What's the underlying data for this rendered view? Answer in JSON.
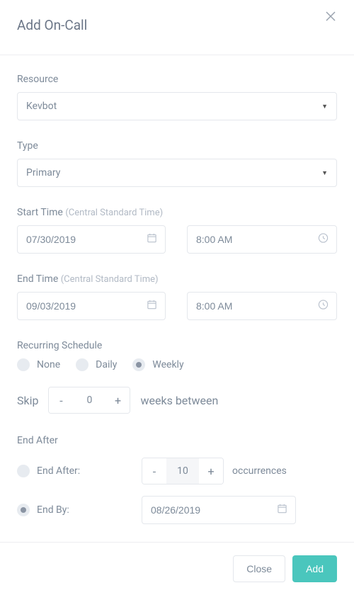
{
  "header": {
    "title": "Add On-Call"
  },
  "resource": {
    "label": "Resource",
    "value": "Kevbot"
  },
  "type": {
    "label": "Type",
    "value": "Primary"
  },
  "start": {
    "label": "Start Time",
    "suffix": "(Central Standard Time)",
    "date": "07/30/2019",
    "time": "8:00 AM"
  },
  "end": {
    "label": "End Time",
    "suffix": "(Central Standard Time)",
    "date": "09/03/2019",
    "time": "8:00 AM"
  },
  "recurring": {
    "label": "Recurring Schedule",
    "options": {
      "none": "None",
      "daily": "Daily",
      "weekly": "Weekly"
    },
    "selected": "weekly",
    "skip": {
      "label": "Skip",
      "value": "0",
      "suffix": "weeks between"
    }
  },
  "endAfter": {
    "label": "End After",
    "endAfterLabel": "End After:",
    "occurrences": "10",
    "occurrencesLabel": "occurrences",
    "endByLabel": "End By:",
    "endByDate": "08/26/2019",
    "selected": "endby"
  },
  "footer": {
    "close": "Close",
    "add": "Add"
  }
}
